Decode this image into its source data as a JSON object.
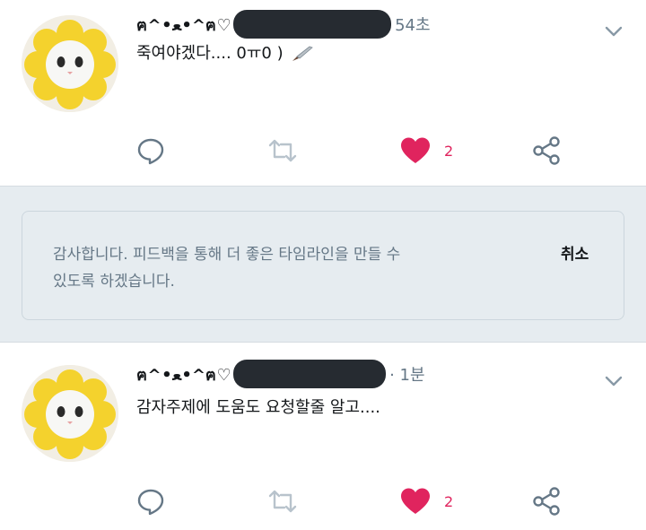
{
  "tweets": [
    {
      "name": "ฅ^•ﻌ•^ฅ♡",
      "time": "54초",
      "text": "죽여야겠다.... 0ㅠ0 )",
      "text_emoji": "knife",
      "likes": "2",
      "liked": true
    },
    {
      "name": "ฅ^•ﻌ•^ฅ♡",
      "time": "· 1분",
      "text": "감자주제에 도움도 요청할줄 알고....",
      "likes": "2",
      "liked": true
    }
  ],
  "feedback": {
    "message_line1": "감사합니다. 피드백을 통해 더 좋은 타임라인을 만들 수",
    "message_line2": "있도록 하겠습니다.",
    "cancel_label": "취소"
  },
  "colors": {
    "like": "#e0245e",
    "secondary": "#657786",
    "band": "#e6ecf0",
    "redaction": "#262b31"
  },
  "icons": [
    "reply-icon",
    "retweet-icon",
    "heart-icon",
    "share-icon",
    "chevron-down-icon",
    "knife-icon"
  ]
}
